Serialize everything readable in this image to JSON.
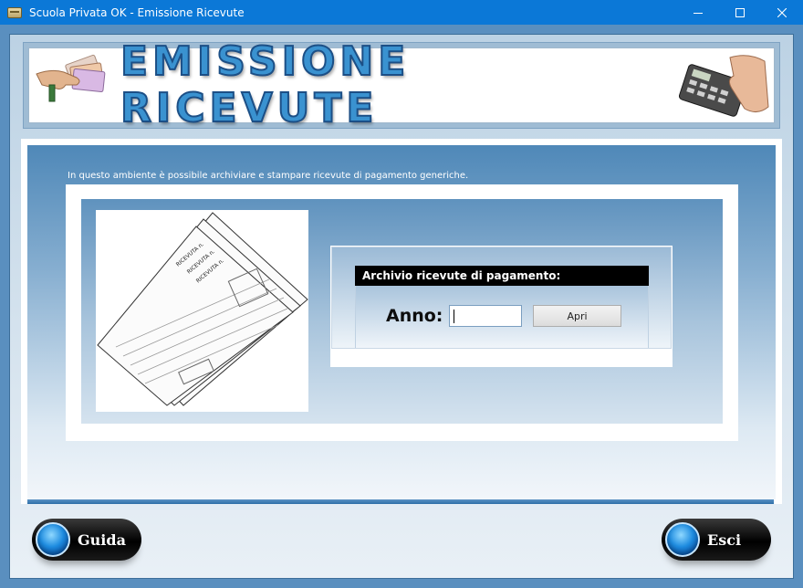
{
  "window": {
    "title": "Scuola Privata OK - Emissione Ricevute",
    "controls": [
      "minimize",
      "maximize",
      "close"
    ]
  },
  "banner": {
    "title": "EMISSIONE RICEVUTE",
    "left_image": "hand-with-banknotes-image",
    "right_image": "calculator-with-hand-image"
  },
  "content": {
    "intro_text": "In questo ambiente è possibile archiviare e stampare ricevute di pagamento generiche.",
    "illustration": "receipts-illustration"
  },
  "archive": {
    "header": "Archivio ricevute di pagamento:",
    "year_label": "Anno:",
    "year_value": "",
    "open_button": "Apri"
  },
  "footer": {
    "help_button": "Guida",
    "exit_button": "Esci"
  },
  "colors": {
    "titlebar": "#0b78d7",
    "frame": "#5a8fbf",
    "banner_text": "#3a92d0",
    "orb": "#1e8ce0"
  }
}
